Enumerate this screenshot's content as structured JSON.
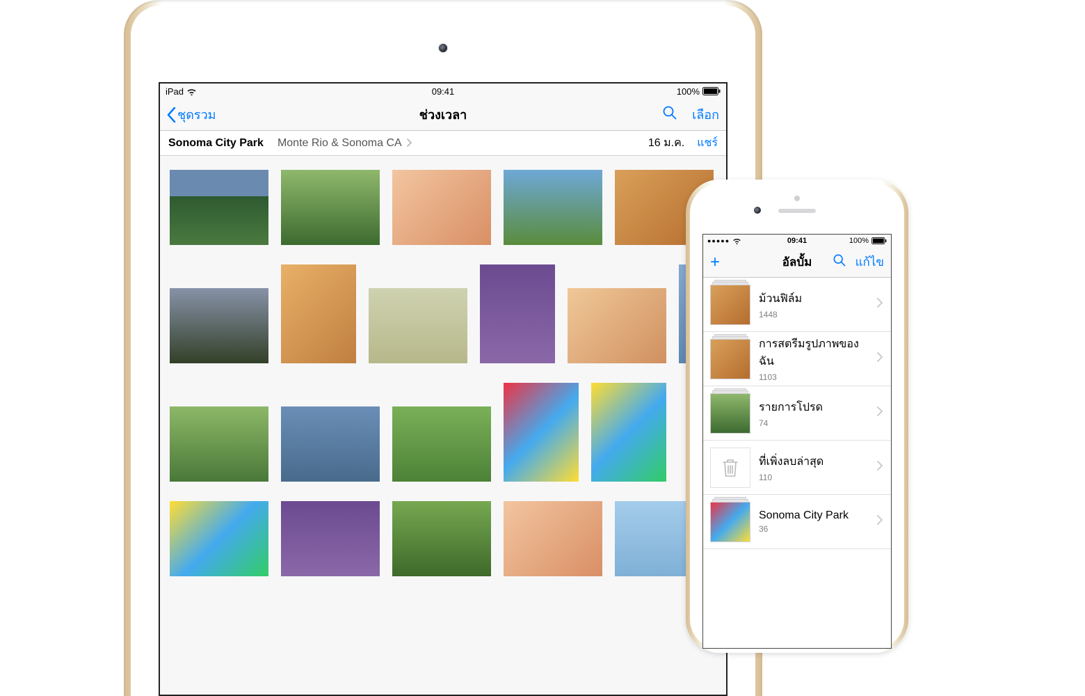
{
  "ipad": {
    "status": {
      "device": "iPad",
      "time": "09:41",
      "battery": "100%"
    },
    "nav": {
      "back": "ชุดรวม",
      "title": "ช่วงเวลา",
      "select": "เลือก"
    },
    "sub": {
      "location_main": "Sonoma City Park",
      "location_sub": "Monte Rio & Sonoma CA",
      "date": "16 ม.ค.",
      "share": "แชร์"
    }
  },
  "iphone": {
    "status": {
      "time": "09:41",
      "battery": "100%"
    },
    "nav": {
      "title": "อัลบั้ม",
      "edit": "แก้ไข"
    },
    "albums": [
      {
        "name": "ม้วนฟิล์ม",
        "count": "1448",
        "thumb": "c5"
      },
      {
        "name": "การสตรีมรูปภาพของฉัน",
        "count": "1103",
        "thumb": "c5"
      },
      {
        "name": "รายการโปรด",
        "count": "74",
        "thumb": "c2"
      },
      {
        "name": "ที่เพิ่งลบล่าสุด",
        "count": "110",
        "thumb": "trash"
      },
      {
        "name": "Sonoma City Park",
        "count": "36",
        "thumb": "c15"
      }
    ]
  }
}
